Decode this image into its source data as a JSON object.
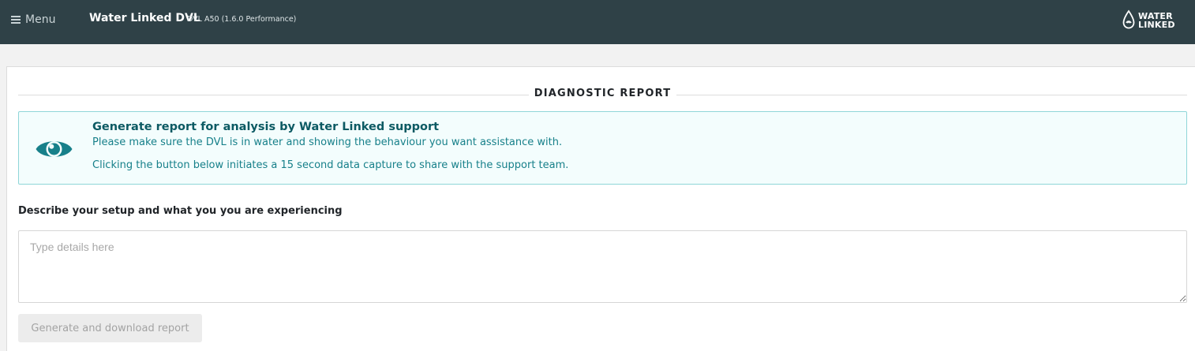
{
  "header": {
    "menu_label": "Menu",
    "app_title": "Water Linked DVL",
    "app_subtitle": "DVL A50 (1.6.0 Performance)",
    "logo_line1": "WATER",
    "logo_line2": "LINKED",
    "bg_color": "#2f4147"
  },
  "section": {
    "title": "DIAGNOSTIC REPORT"
  },
  "alert": {
    "icon": "eye-icon",
    "heading": "Generate report for analysis by Water Linked support",
    "line1": "Please make sure the DVL is in water and showing the behaviour you want assistance with.",
    "line2": "Clicking the button below initiates a 15 second data capture to share with the support team.",
    "accent_color": "#17808a"
  },
  "form": {
    "label": "Describe your setup and what you you are experiencing",
    "placeholder": "Type details here",
    "value": "",
    "button_label": "Generate and download report",
    "button_disabled": true
  }
}
